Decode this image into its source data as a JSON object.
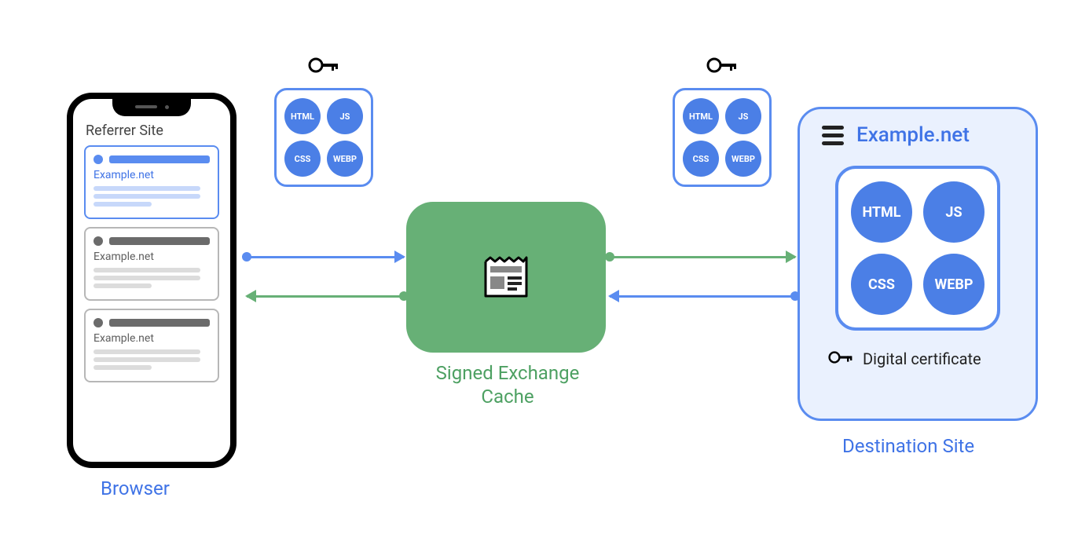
{
  "browser": {
    "label": "Browser",
    "referrer_title": "Referrer Site",
    "cards": [
      {
        "name": "Example.net",
        "variant": "blue"
      },
      {
        "name": "Example.net",
        "variant": "grey"
      },
      {
        "name": "Example.net",
        "variant": "grey"
      }
    ]
  },
  "packages": {
    "pkg_a": {
      "assets": [
        "HTML",
        "JS",
        "CSS",
        "WEBP"
      ]
    },
    "pkg_b": {
      "assets": [
        "HTML",
        "JS",
        "CSS",
        "WEBP"
      ]
    }
  },
  "cache": {
    "label": "Signed Exchange Cache"
  },
  "destination": {
    "title": "Example.net",
    "assets": [
      "HTML",
      "JS",
      "CSS",
      "WEBP"
    ],
    "certificate_label": "Digital certificate",
    "label": "Destination Site"
  },
  "colors": {
    "blue": "#5a8cf0",
    "blue_text": "#3f73e6",
    "green_fill": "#67b076",
    "green_text": "#4da062",
    "light_blue_bg": "#eaf1fe"
  }
}
